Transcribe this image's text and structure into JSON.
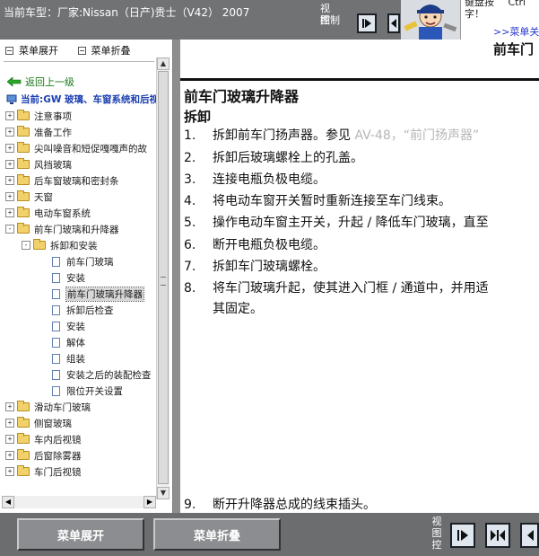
{
  "header": {
    "vehicle_label": "当前车型：厂家:Nissan（日产)贵士（V42） 2007",
    "view_control": [
      "视",
      "图",
      "控",
      "制"
    ],
    "bubble_line1": "键盘按",
    "bubble_line2": "字！",
    "bubble_right": "Ctrl",
    "bubble_link": ">>菜单关"
  },
  "left_panel": {
    "expand_label": "菜单展开",
    "collapse_label": "菜单折叠",
    "back_label": "返回上一级",
    "current_label": "当前:GW 玻璃、车窗系统和后视镜",
    "tree": [
      {
        "label": "注意事项",
        "kind": "folder",
        "sign": "+"
      },
      {
        "label": "准备工作",
        "kind": "folder",
        "sign": "+"
      },
      {
        "label": "尖叫噪音和短促嘎嘎声的故",
        "kind": "folder",
        "sign": "+"
      },
      {
        "label": "风挡玻璃",
        "kind": "folder",
        "sign": "+"
      },
      {
        "label": "后车窗玻璃和密封条",
        "kind": "folder",
        "sign": "+"
      },
      {
        "label": "天窗",
        "kind": "folder",
        "sign": "+"
      },
      {
        "label": "电动车窗系统",
        "kind": "folder",
        "sign": "+"
      },
      {
        "label": "前车门玻璃和升降器",
        "kind": "folder",
        "sign": "-"
      },
      {
        "label": "拆卸和安装",
        "kind": "folder",
        "sign": "-"
      },
      {
        "label": "前车门玻璃",
        "kind": "doc"
      },
      {
        "label": "安装",
        "kind": "doc"
      },
      {
        "label": "前车门玻璃升降器",
        "kind": "doc",
        "selected": true
      },
      {
        "label": "拆卸后检查",
        "kind": "doc"
      },
      {
        "label": "安装",
        "kind": "doc"
      },
      {
        "label": "解体",
        "kind": "doc"
      },
      {
        "label": "组装",
        "kind": "doc"
      },
      {
        "label": "安装之后的装配检查",
        "kind": "doc"
      },
      {
        "label": "限位开关设置",
        "kind": "doc"
      },
      {
        "label": "滑动车门玻璃",
        "kind": "folder",
        "sign": "+"
      },
      {
        "label": "侧窗玻璃",
        "kind": "folder",
        "sign": "+"
      },
      {
        "label": "车内后视镜",
        "kind": "folder",
        "sign": "+"
      },
      {
        "label": "后窗除雾器",
        "kind": "folder",
        "sign": "+"
      },
      {
        "label": "车门后视镜",
        "kind": "folder",
        "sign": "+"
      }
    ]
  },
  "document": {
    "header_title": "前车门",
    "title": "前车门玻璃升降器",
    "subtitle": "拆卸",
    "steps": [
      {
        "num": "1.",
        "text": "拆卸前车门扬声器。参见 ",
        "link": "AV-48，“前门扬声器”"
      },
      {
        "num": "2.",
        "text": "拆卸后玻璃螺栓上的孔盖。"
      },
      {
        "num": "3.",
        "text": "连接电瓶负极电缆。"
      },
      {
        "num": "4.",
        "text": "将电动车窗开关暂时重新连接至车门线束。"
      },
      {
        "num": "5.",
        "text": "操作电动车窗主开关，升起 / 降低车门玻璃，直至"
      },
      {
        "num": "6.",
        "text": "断开电瓶负极电缆。"
      },
      {
        "num": "7.",
        "text": "拆卸车门玻璃螺栓。"
      },
      {
        "num": "8.",
        "text": "将车门玻璃升起，使其进入门框 / 通道中，并用适"
      },
      {
        "num": "9.",
        "text": "断开升降器总成的线束插头。"
      }
    ],
    "step8_cont": "其固定。"
  },
  "bottom": {
    "expand_label": "菜单展开",
    "collapse_label": "菜单折叠",
    "view_control": [
      "视",
      "图",
      "控"
    ]
  }
}
